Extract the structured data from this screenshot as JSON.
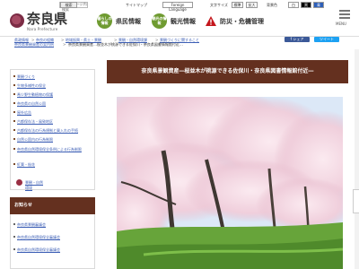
{
  "header": {
    "logo_text": "奈良県",
    "logo_sub": "Nara Prefecture",
    "search_placeholder": "ホームページ内検索",
    "search_button": "検索",
    "site_map": "サイトマップ",
    "foreign_language": "Foreign Language",
    "font_size_label": "文字サイズ",
    "font_sizes": [
      "標準",
      "拡大"
    ],
    "color_label": "背景色",
    "color_options": [
      "白",
      "黒",
      "青"
    ],
    "menu_label": "MENU"
  },
  "nav": [
    {
      "icon_text": "暮らしの情報",
      "label": "県民情報"
    },
    {
      "icon_text": "観光の情報",
      "label": "観光情報"
    },
    {
      "icon_text": "",
      "label": "防災・危機管理"
    }
  ],
  "breadcrumb": {
    "row1": [
      "県政情報",
      "奈良の組織",
      "地域振興・県土・景観",
      "景観・自然環境課",
      "景観づくりに関すること"
    ],
    "row2_link": "奈良県景観資産の案内例",
    "row2_current": "奈良県景観資産…桜並木が桃源できる佐保川・奈良県図書情報館付近…"
  },
  "share": {
    "facebook": "f シェア",
    "twitter": "ツイート"
  },
  "sidebar": {
    "items": [
      "景観づくり",
      "生物多様性の保全",
      "希少野生動植物の保護",
      "奈良県の自然公園",
      "屋外広告",
      "古都保存法・風致地区",
      "古都保存法の行為規制と買入れの手続",
      "自然公園内の行為制限",
      "奈良県自然環境保全条例による行為制限",
      "紅葉・桜花"
    ],
    "bottom_link": "景観・自然環境"
  },
  "notice": {
    "heading": "お知らせ",
    "items": [
      "奈良県景観審議会",
      "奈良県自然環境保全審議会",
      "奈良県自然環境保全審議会"
    ]
  },
  "main": {
    "title": "奈良県景観資産―桜並木が桃源できる佐保川・奈良県図書情報館付近―"
  },
  "colors": {
    "brand_green": "#6f9b31",
    "title_brown": "#64301f",
    "logo_red": "#7c2c45"
  }
}
